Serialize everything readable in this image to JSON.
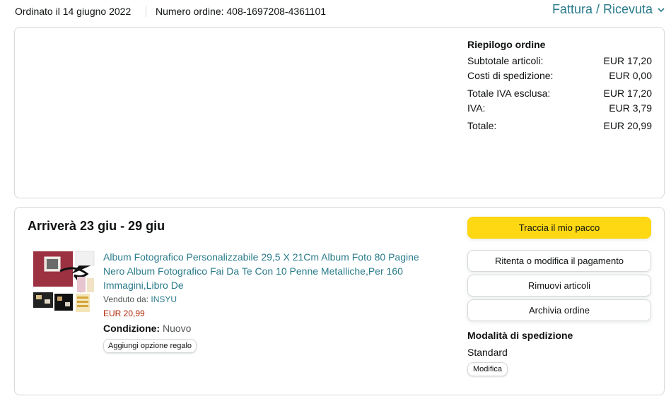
{
  "header": {
    "ordered_date": "Ordinato il 14 giugno 2022",
    "order_number": "Numero ordine: 408-1697208-4361101",
    "invoice_link": "Fattura / Ricevuta"
  },
  "summary": {
    "title": "Riepilogo ordine",
    "rows": [
      {
        "label": "Subtotale articoli:",
        "value": "EUR 17,20"
      },
      {
        "label": "Costi di spedizione:",
        "value": "EUR 0,00"
      },
      {
        "label": "Totale IVA esclusa:",
        "value": "EUR 17,20"
      },
      {
        "label": "IVA:",
        "value": "EUR 3,79"
      },
      {
        "label": "Totale:",
        "value": "EUR 20,99"
      }
    ]
  },
  "shipment": {
    "arrival": "Arriverà 23 giu - 29 giu",
    "product": {
      "title": "Album Fotografico Personalizzabile 29,5 X 21Cm Album Foto 80 Pagine Nero Album Fotografico Fai Da Te Con 10 Penne Metalliche,Per 160 Immagini,Libro De",
      "sold_by_label": "Venduto da:",
      "seller": "INSYU",
      "price": "EUR 20,99",
      "condition_label": "Condizione:",
      "condition_value": "Nuovo",
      "gift_button": "Aggiungi opzione regalo"
    },
    "actions": {
      "track": "Traccia il mio pacco",
      "retry_payment": "Ritenta o modifica il pagamento",
      "remove_items": "Rimuovi articoli",
      "archive": "Archivia ordine"
    },
    "shipping_method_title": "Modalità di spedizione",
    "shipping_method": "Standard",
    "modify_button": "Modifica"
  },
  "colors": {
    "link": "#2a7b8b",
    "price": "#b12704",
    "primary_button": "#ffd814",
    "border": "#d5d9d9"
  }
}
